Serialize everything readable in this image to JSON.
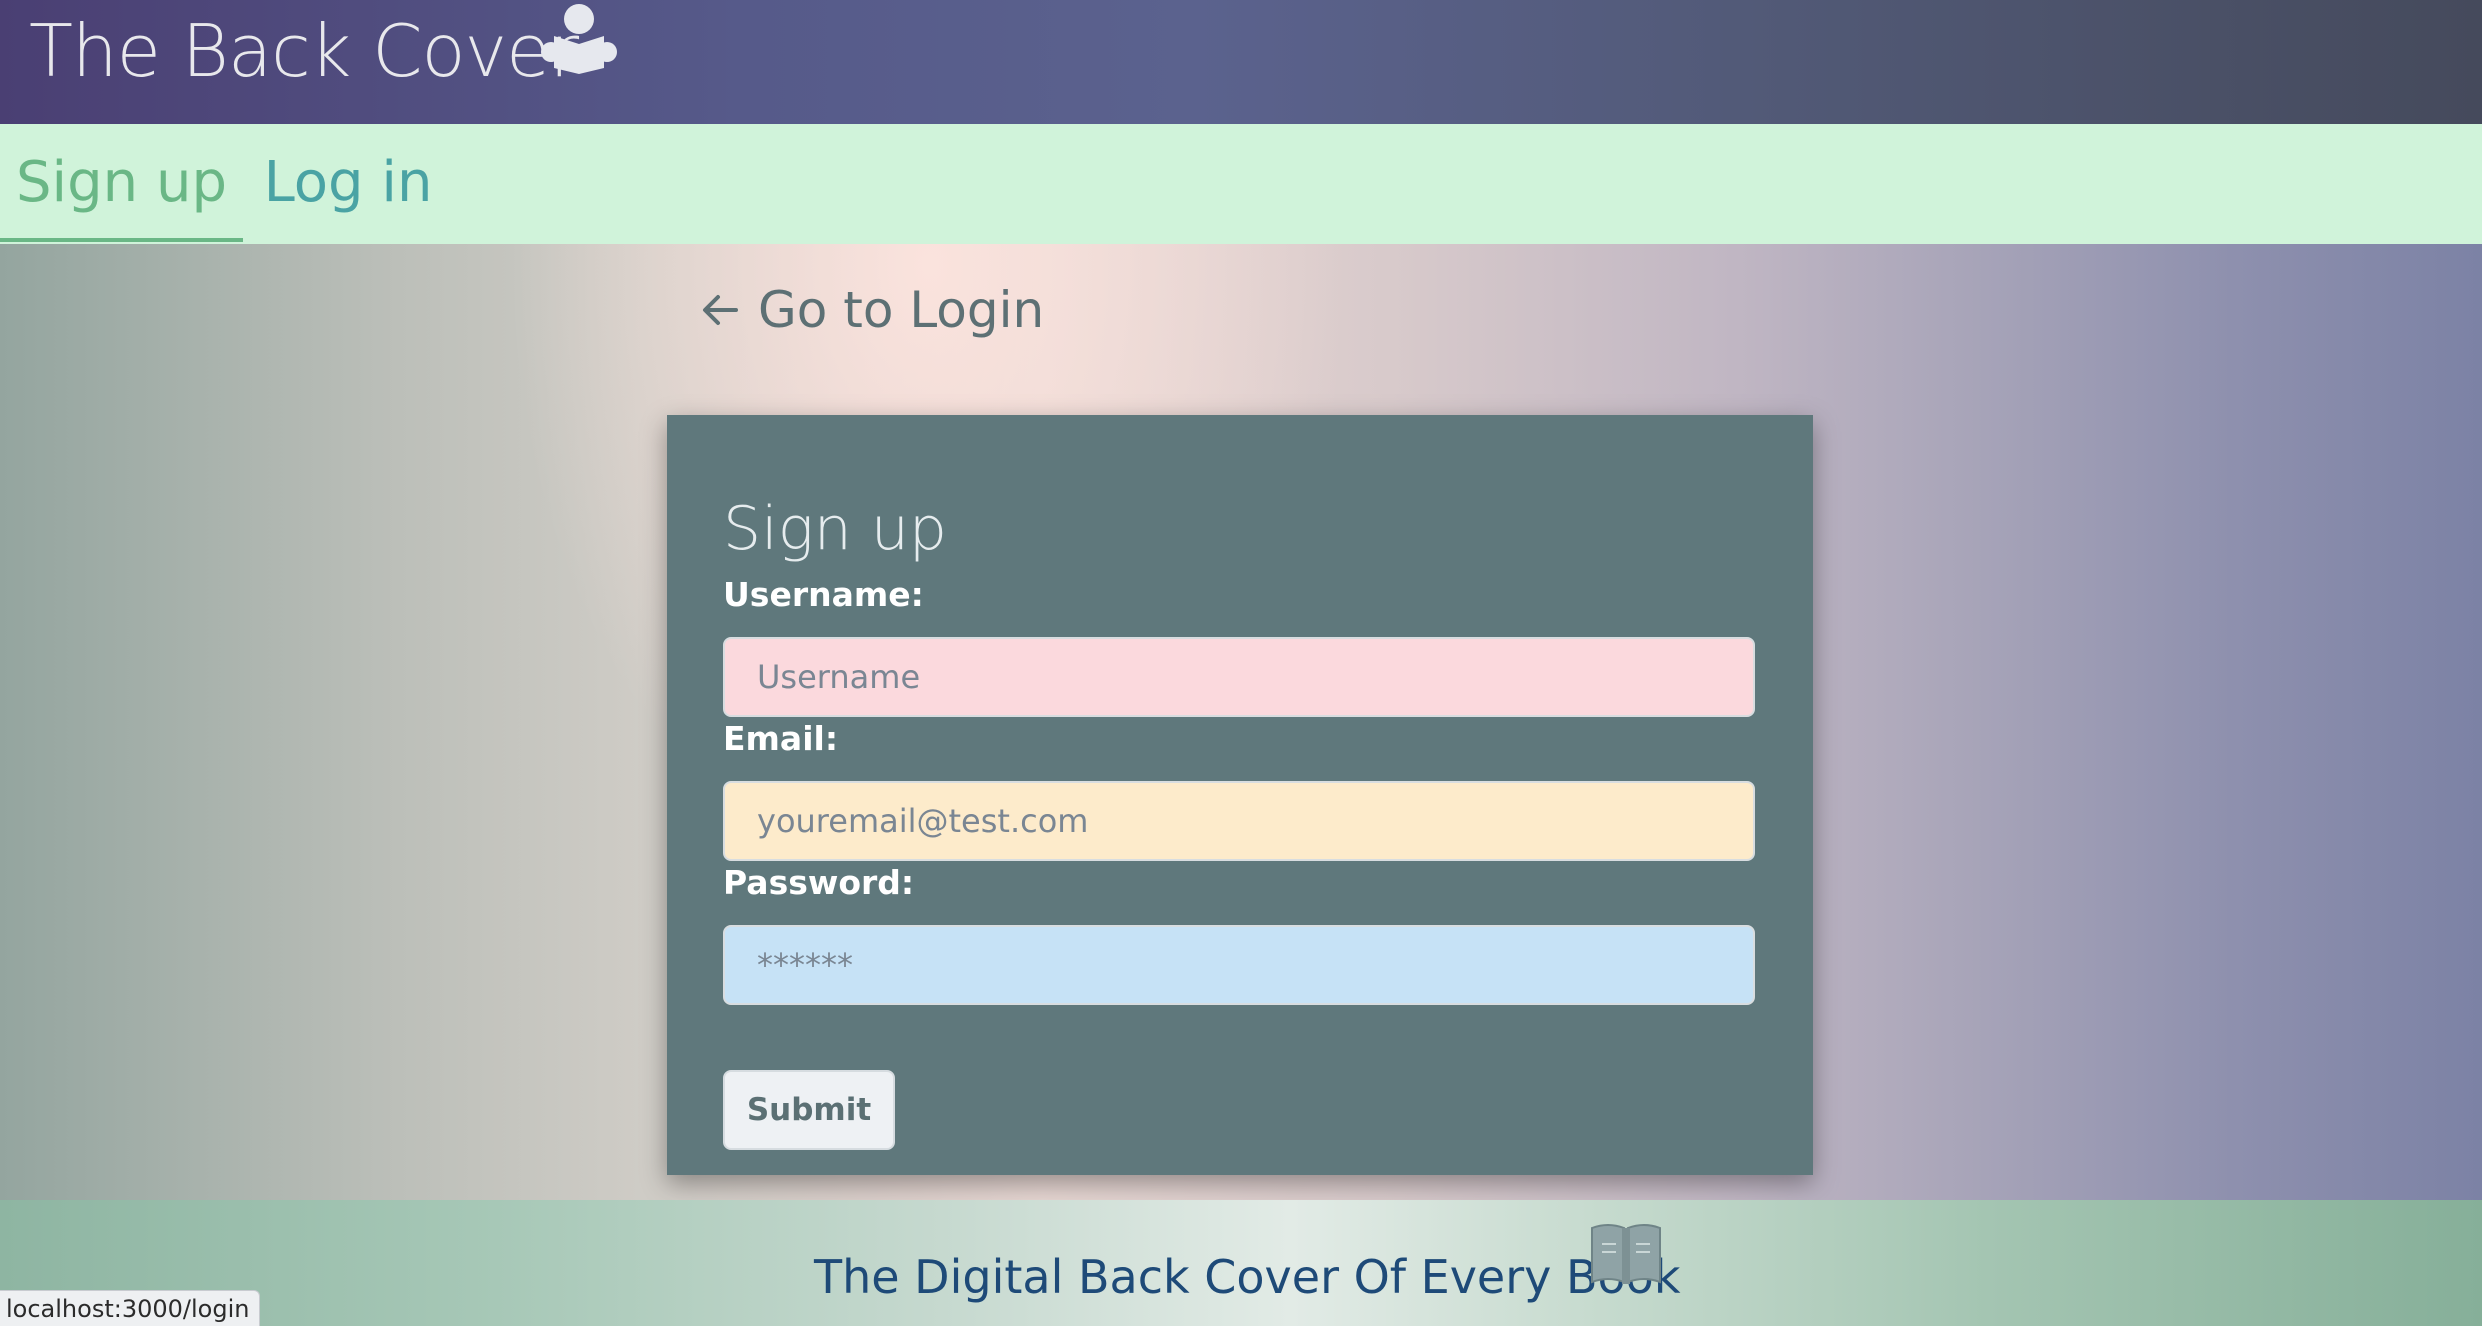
{
  "header": {
    "brand": "The Back Cover",
    "brand_icon": "reader-icon"
  },
  "nav": {
    "tabs": [
      {
        "label": "Sign up",
        "active": true
      },
      {
        "label": "Log in",
        "active": false
      }
    ]
  },
  "main": {
    "back_link": "Go to Login",
    "form": {
      "title": "Sign up",
      "username_label": "Username:",
      "username_placeholder": "Username",
      "email_label": "Email:",
      "email_placeholder": "youremail@test.com",
      "password_label": "Password:",
      "password_placeholder": "******",
      "submit_label": "Submit"
    }
  },
  "footer": {
    "text": "The Digital Back Cover Of Every Book",
    "icon": "open-book-icon"
  },
  "status_bar": {
    "url": "localhost:3000/login"
  },
  "colors": {
    "accent_green": "#6ab786",
    "accent_teal": "#4aa3a4",
    "card_bg": "#5f787c",
    "username_bg": "#fbd9dd",
    "email_bg": "#fdebcb",
    "password_bg": "#c6e2f6",
    "footer_text": "#1e4a78"
  }
}
